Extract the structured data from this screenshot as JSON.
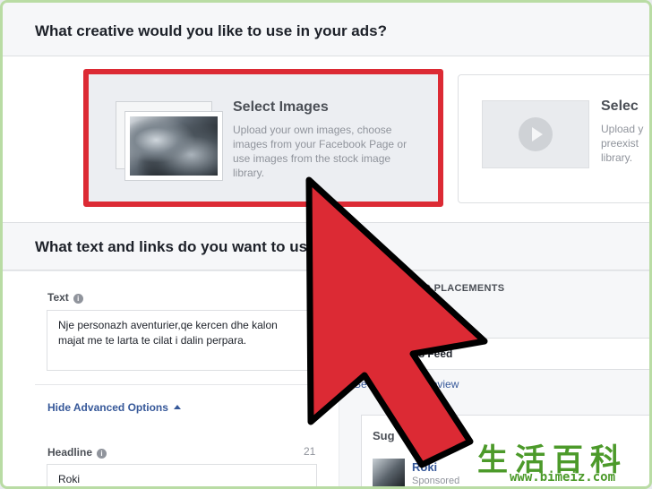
{
  "sections": {
    "creative_header": "What creative would you like to use in your ads?",
    "text_links_header": "What text and links do you want to use"
  },
  "creative_options": {
    "images": {
      "title": "Select Images",
      "description": "Upload your own images, choose images from your Facebook Page or use images from the stock image library."
    },
    "video": {
      "title": "Selec",
      "description_lines": [
        "Upload y",
        "preexist",
        "library."
      ]
    }
  },
  "form": {
    "text_label": "Text",
    "text_value": "Nje personazh aventurier,qe kercen dhe kalon majat me te larta te cilat i dalin perpara.",
    "advanced_options_link": "Hide Advanced Options",
    "headline_label": "Headline",
    "headline_char_count": "21",
    "headline_value": "Roki"
  },
  "preview": {
    "placements_label": "D PLACEMENTS",
    "news_feed_label": "ws Feed",
    "preview_link": "Se",
    "preview_link_tail": "hone Preview",
    "suggested_page_label": "Sug",
    "suggested_page_tail": "Page",
    "page_name": "Roki",
    "sponsored_label": "Sponsored"
  },
  "watermark": {
    "chars": "生活百科",
    "url": "www.bimeiz.com"
  },
  "colors": {
    "highlight_border": "#dc2a34",
    "arrow": "#dc2a34",
    "link": "#365899",
    "watermark": "#4c9a2a"
  }
}
